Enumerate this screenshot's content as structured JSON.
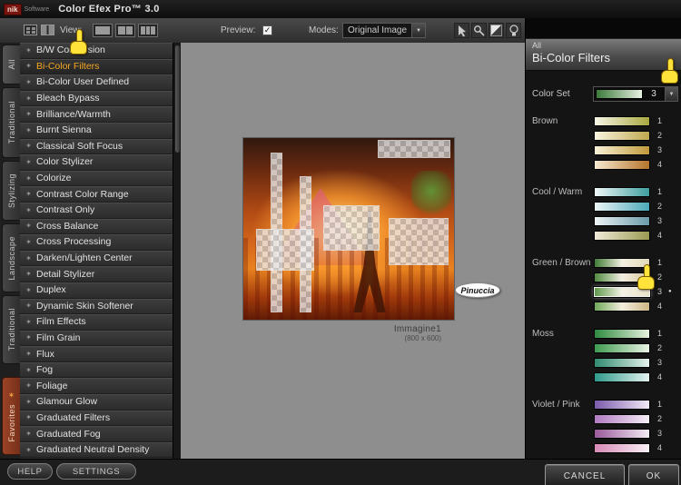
{
  "colors": {
    "accent_orange": "#f5a623",
    "favorites_tab": "#8c3520",
    "hand_yellow": "#ffe23a",
    "preview_bg": "#8e8e8e"
  },
  "icons": {
    "dropdown_arrow": "▼"
  },
  "titlebar": {
    "logo_nik": "nik",
    "logo_software": "Software",
    "title": "Color Efex Pro™ 3.0"
  },
  "toolbar": {
    "view_label": "View:",
    "preview_label": "Preview:",
    "preview_checked": true,
    "check_glyph": "✓",
    "modes_label": "Modes:",
    "modes_value": "Original Image"
  },
  "sidebar_tabs": [
    {
      "label": "All"
    },
    {
      "label": "Traditional"
    },
    {
      "label": "Stylizing"
    },
    {
      "label": "Landscape"
    },
    {
      "label": "Traditional"
    },
    {
      "label": "Favorites",
      "accent": true,
      "icon": "✶"
    }
  ],
  "filters": {
    "star_icon": "✶",
    "items": [
      {
        "label": "B/W Conversion"
      },
      {
        "label": "Bi-Color Filters",
        "selected": true
      },
      {
        "label": "Bi-Color User Defined"
      },
      {
        "label": "Bleach Bypass"
      },
      {
        "label": "Brilliance/Warmth"
      },
      {
        "label": "Burnt Sienna"
      },
      {
        "label": "Classical Soft Focus"
      },
      {
        "label": "Color Stylizer"
      },
      {
        "label": "Colorize"
      },
      {
        "label": "Contrast Color Range"
      },
      {
        "label": "Contrast Only"
      },
      {
        "label": "Cross Balance"
      },
      {
        "label": "Cross Processing"
      },
      {
        "label": "Darken/Lighten Center"
      },
      {
        "label": "Detail Stylizer"
      },
      {
        "label": "Duplex"
      },
      {
        "label": "Dynamic Skin Softener"
      },
      {
        "label": "Film Effects"
      },
      {
        "label": "Film Grain"
      },
      {
        "label": "Flux"
      },
      {
        "label": "Fog"
      },
      {
        "label": "Foliage"
      },
      {
        "label": "Glamour Glow"
      },
      {
        "label": "Graduated Filters"
      },
      {
        "label": "Graduated Fog"
      },
      {
        "label": "Graduated Neutral Density"
      }
    ]
  },
  "preview": {
    "image_name": "Immagine1",
    "image_size": "(800 x 600)",
    "annotation": "Pinuccia"
  },
  "right_panel": {
    "category": "All",
    "title": "Bi-Color Filters",
    "color_set_label": "Color Set",
    "color_set_value": "3",
    "color_set_stops": [
      "#3a7a3a",
      "#eaf2e2"
    ],
    "selected_dot": "●",
    "groups": [
      {
        "name": "Brown",
        "swatches": [
          {
            "n": "1",
            "stops": [
              "#f8f6e8",
              "#a8a83f"
            ]
          },
          {
            "n": "2",
            "stops": [
              "#f8f4e0",
              "#bfa84e"
            ]
          },
          {
            "n": "3",
            "stops": [
              "#f8f2d8",
              "#c09a3a"
            ]
          },
          {
            "n": "4",
            "stops": [
              "#f6ead0",
              "#b5742c"
            ]
          }
        ]
      },
      {
        "name": "Cool / Warm",
        "swatches": [
          {
            "n": "1",
            "stops": [
              "#f0f8f8",
              "#3f9ea0"
            ]
          },
          {
            "n": "2",
            "stops": [
              "#eef6f8",
              "#4aa8b8"
            ]
          },
          {
            "n": "3",
            "stops": [
              "#eef4f6",
              "#6a9aa8"
            ]
          },
          {
            "n": "4",
            "stops": [
              "#f0ead8",
              "#9a9a52"
            ]
          }
        ]
      },
      {
        "name": "Green / Brown",
        "swatches": [
          {
            "n": "1",
            "stops": [
              "#3f7a33",
              "#f2efe2",
              "#e2d8b8"
            ]
          },
          {
            "n": "2",
            "stops": [
              "#4f8a3f",
              "#f2efe2",
              "#d8c89a"
            ]
          },
          {
            "n": "3",
            "stops": [
              "#5f9a4b",
              "#f4f2e6",
              "#e8e2c8"
            ],
            "selected": true
          },
          {
            "n": "4",
            "stops": [
              "#6fa858",
              "#f2eede",
              "#cdb684"
            ]
          }
        ]
      },
      {
        "name": "Moss",
        "swatches": [
          {
            "n": "1",
            "stops": [
              "#2f8a3f",
              "#e8f2e0"
            ]
          },
          {
            "n": "2",
            "stops": [
              "#3f9a4f",
              "#eaf4e4"
            ]
          },
          {
            "n": "3",
            "stops": [
              "#2f8a6f",
              "#e6f2ec"
            ]
          },
          {
            "n": "4",
            "stops": [
              "#2f9a8a",
              "#e4f2f0"
            ]
          }
        ]
      },
      {
        "name": "Violet / Pink",
        "swatches": [
          {
            "n": "1",
            "stops": [
              "#7a5aaa",
              "#f2eaf6"
            ]
          },
          {
            "n": "2",
            "stops": [
              "#b07ac0",
              "#f6eef8"
            ]
          },
          {
            "n": "3",
            "stops": [
              "#9a5a9a",
              "#f4ecf4"
            ]
          },
          {
            "n": "4",
            "stops": [
              "#d88ab8",
              "#f8f0f4"
            ]
          }
        ]
      }
    ]
  },
  "footer": {
    "help_label": "HELP",
    "settings_label": "SETTINGS",
    "cancel_label": "CANCEL",
    "ok_label": "OK"
  }
}
